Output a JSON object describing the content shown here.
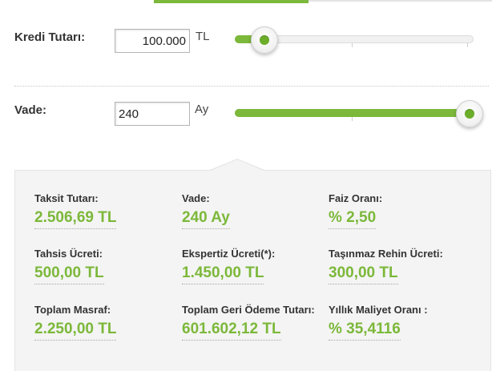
{
  "colors": {
    "accent": "#7cb83a",
    "panel": "#f4f4f4",
    "text": "#333333"
  },
  "loan_amount": {
    "label": "Kredi Tutarı:",
    "value": "100.000",
    "unit": "TL",
    "slider_level": 0.12
  },
  "term": {
    "label": "Vade:",
    "value": "240",
    "unit": "Ay",
    "slider_level": 1.0
  },
  "results": [
    {
      "label": "Taksit Tutarı:",
      "value": "2.506,69 TL"
    },
    {
      "label": "Vade:",
      "value": "240 Ay"
    },
    {
      "label": "Faiz Oranı:",
      "value": "% 2,50"
    },
    {
      "label": "Tahsis Ücreti:",
      "value": "500,00 TL"
    },
    {
      "label": "Ekspertiz Ücreti(*):",
      "value": "1.450,00 TL"
    },
    {
      "label": "Taşınmaz Rehin Ücreti:",
      "value": "300,00 TL"
    },
    {
      "label": "Toplam Masraf:",
      "value": "2.250,00 TL"
    },
    {
      "label": "Toplam Geri Ödeme Tutarı:",
      "value": "601.602,12 TL"
    },
    {
      "label": "Yıllık Maliyet Oranı :",
      "value": "% 35,4116"
    }
  ],
  "icons": {
    "slider_knob": "slider-knob-icon"
  }
}
